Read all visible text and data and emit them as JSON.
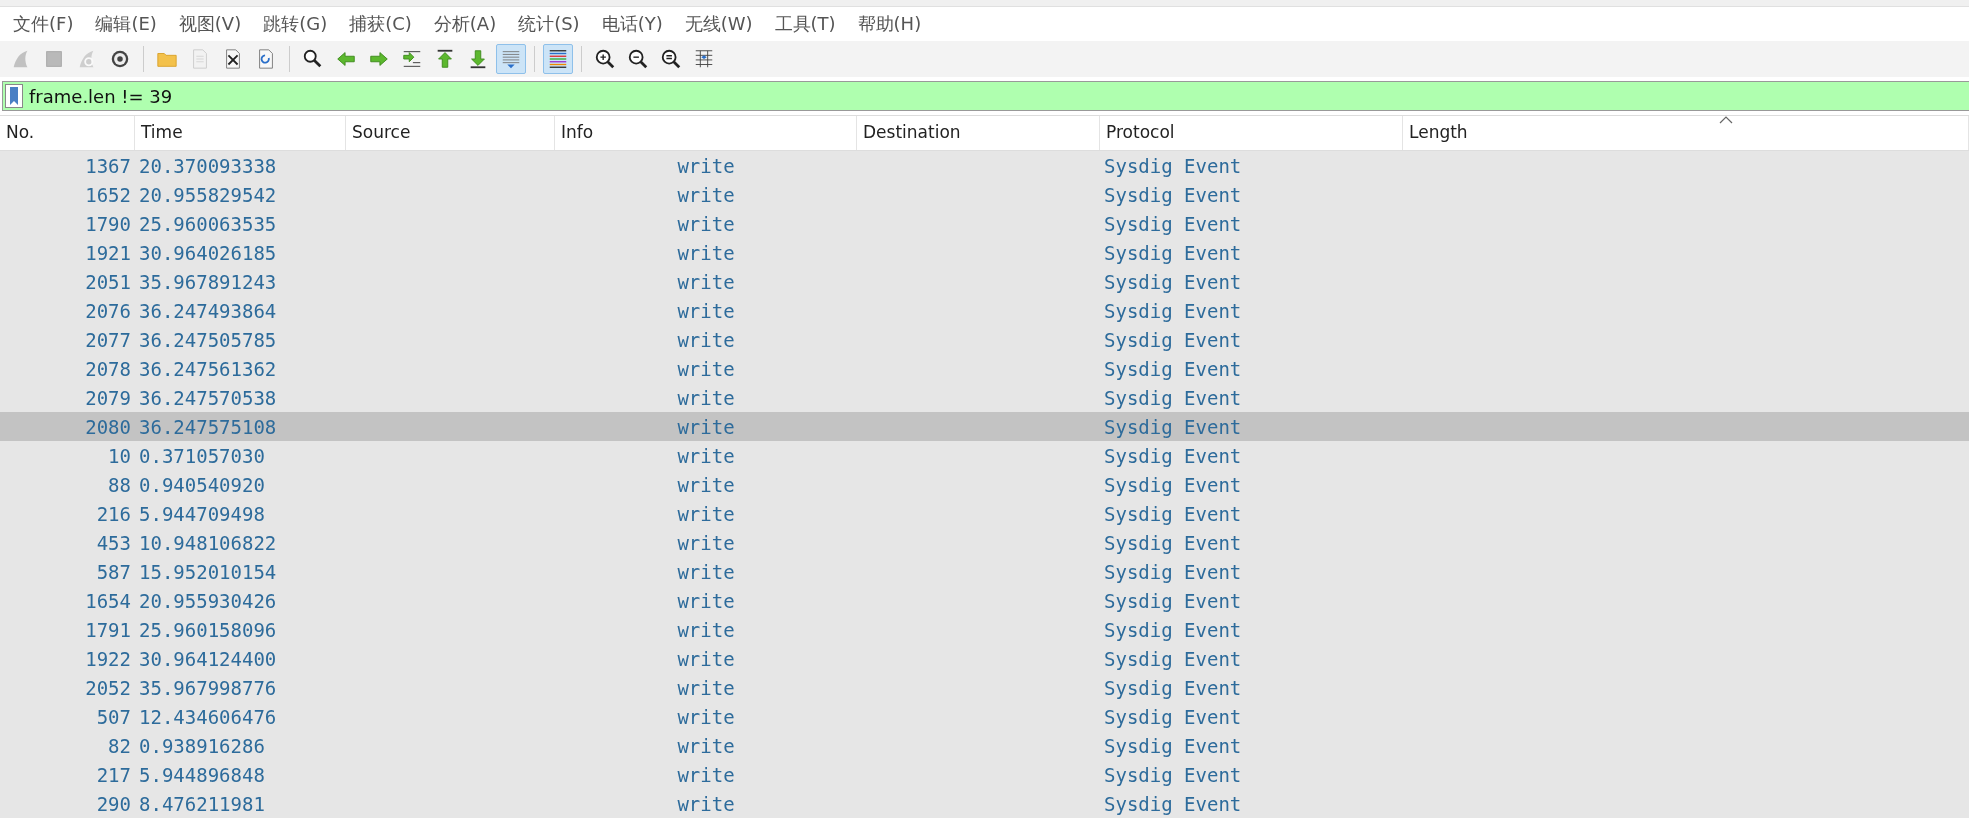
{
  "menu_bar": [
    {
      "label": "文件(F)"
    },
    {
      "label": "编辑(E)"
    },
    {
      "label": "视图(V)"
    },
    {
      "label": "跳转(G)"
    },
    {
      "label": "捕获(C)"
    },
    {
      "label": "分析(A)"
    },
    {
      "label": "统计(S)"
    },
    {
      "label": "电话(Y)"
    },
    {
      "label": "无线(W)"
    },
    {
      "label": "工具(T)"
    },
    {
      "label": "帮助(H)"
    }
  ],
  "toolbar": [
    {
      "kind": "fin",
      "disabled": true,
      "on": false
    },
    {
      "kind": "stop",
      "disabled": true,
      "on": false
    },
    {
      "kind": "restart",
      "disabled": true,
      "on": false
    },
    {
      "kind": "gear",
      "disabled": false,
      "on": false
    },
    {
      "kind": "separator"
    },
    {
      "kind": "folder",
      "disabled": false,
      "on": false
    },
    {
      "kind": "document",
      "disabled": true,
      "on": false
    },
    {
      "kind": "document-x",
      "disabled": false,
      "on": false
    },
    {
      "kind": "reload",
      "disabled": false,
      "on": false
    },
    {
      "kind": "separator"
    },
    {
      "kind": "search",
      "disabled": false,
      "on": false
    },
    {
      "kind": "left",
      "disabled": false,
      "on": false
    },
    {
      "kind": "right",
      "disabled": false,
      "on": false
    },
    {
      "kind": "jump",
      "disabled": false,
      "on": false
    },
    {
      "kind": "up",
      "disabled": false,
      "on": false
    },
    {
      "kind": "down",
      "disabled": false,
      "on": false
    },
    {
      "kind": "autoscroll",
      "disabled": false,
      "on": true
    },
    {
      "kind": "separator"
    },
    {
      "kind": "colorize",
      "disabled": false,
      "on": true
    },
    {
      "kind": "separator"
    },
    {
      "kind": "zoom-in",
      "disabled": false,
      "on": false
    },
    {
      "kind": "zoom-out",
      "disabled": false,
      "on": false
    },
    {
      "kind": "zoom-reset",
      "disabled": false,
      "on": false
    },
    {
      "kind": "columns",
      "disabled": false,
      "on": false
    }
  ],
  "display_filter": {
    "value": "frame.len != 39"
  },
  "table": {
    "columns": [
      {
        "label": "No.",
        "sorted": false
      },
      {
        "label": "Time",
        "sorted": false
      },
      {
        "label": "Source",
        "sorted": false
      },
      {
        "label": "Info",
        "sorted": false
      },
      {
        "label": "Destination",
        "sorted": false
      },
      {
        "label": "Protocol",
        "sorted": false
      },
      {
        "label": "Length",
        "sorted": true
      }
    ],
    "rows": [
      {
        "no": "1367",
        "time": "20.370093338",
        "info": "write",
        "protocol": "Sysdig Event",
        "selected": false
      },
      {
        "no": "1652",
        "time": "20.955829542",
        "info": "write",
        "protocol": "Sysdig Event",
        "selected": false
      },
      {
        "no": "1790",
        "time": "25.960063535",
        "info": "write",
        "protocol": "Sysdig Event",
        "selected": false
      },
      {
        "no": "1921",
        "time": "30.964026185",
        "info": "write",
        "protocol": "Sysdig Event",
        "selected": false
      },
      {
        "no": "2051",
        "time": "35.967891243",
        "info": "write",
        "protocol": "Sysdig Event",
        "selected": false
      },
      {
        "no": "2076",
        "time": "36.247493864",
        "info": "write",
        "protocol": "Sysdig Event",
        "selected": false
      },
      {
        "no": "2077",
        "time": "36.247505785",
        "info": "write",
        "protocol": "Sysdig Event",
        "selected": false
      },
      {
        "no": "2078",
        "time": "36.247561362",
        "info": "write",
        "protocol": "Sysdig Event",
        "selected": false
      },
      {
        "no": "2079",
        "time": "36.247570538",
        "info": "write",
        "protocol": "Sysdig Event",
        "selected": false
      },
      {
        "no": "2080",
        "time": "36.247575108",
        "info": "write",
        "protocol": "Sysdig Event",
        "selected": true
      },
      {
        "no": "10",
        "time": "0.371057030",
        "info": "write",
        "protocol": "Sysdig Event",
        "selected": false
      },
      {
        "no": "88",
        "time": "0.940540920",
        "info": "write",
        "protocol": "Sysdig Event",
        "selected": false
      },
      {
        "no": "216",
        "time": "5.944709498",
        "info": "write",
        "protocol": "Sysdig Event",
        "selected": false
      },
      {
        "no": "453",
        "time": "10.948106822",
        "info": "write",
        "protocol": "Sysdig Event",
        "selected": false
      },
      {
        "no": "587",
        "time": "15.952010154",
        "info": "write",
        "protocol": "Sysdig Event",
        "selected": false
      },
      {
        "no": "1654",
        "time": "20.955930426",
        "info": "write",
        "protocol": "Sysdig Event",
        "selected": false
      },
      {
        "no": "1791",
        "time": "25.960158096",
        "info": "write",
        "protocol": "Sysdig Event",
        "selected": false
      },
      {
        "no": "1922",
        "time": "30.964124400",
        "info": "write",
        "protocol": "Sysdig Event",
        "selected": false
      },
      {
        "no": "2052",
        "time": "35.967998776",
        "info": "write",
        "protocol": "Sysdig Event",
        "selected": false
      },
      {
        "no": "507",
        "time": "12.434606476",
        "info": "write",
        "protocol": "Sysdig Event",
        "selected": false
      },
      {
        "no": "82",
        "time": "0.938916286",
        "info": "write",
        "protocol": "Sysdig Event",
        "selected": false
      },
      {
        "no": "217",
        "time": "5.944896848",
        "info": "write",
        "protocol": "Sysdig Event",
        "selected": false
      },
      {
        "no": "290",
        "time": "8.476211981",
        "info": "write",
        "protocol": "Sysdig Event",
        "selected": false
      }
    ]
  }
}
